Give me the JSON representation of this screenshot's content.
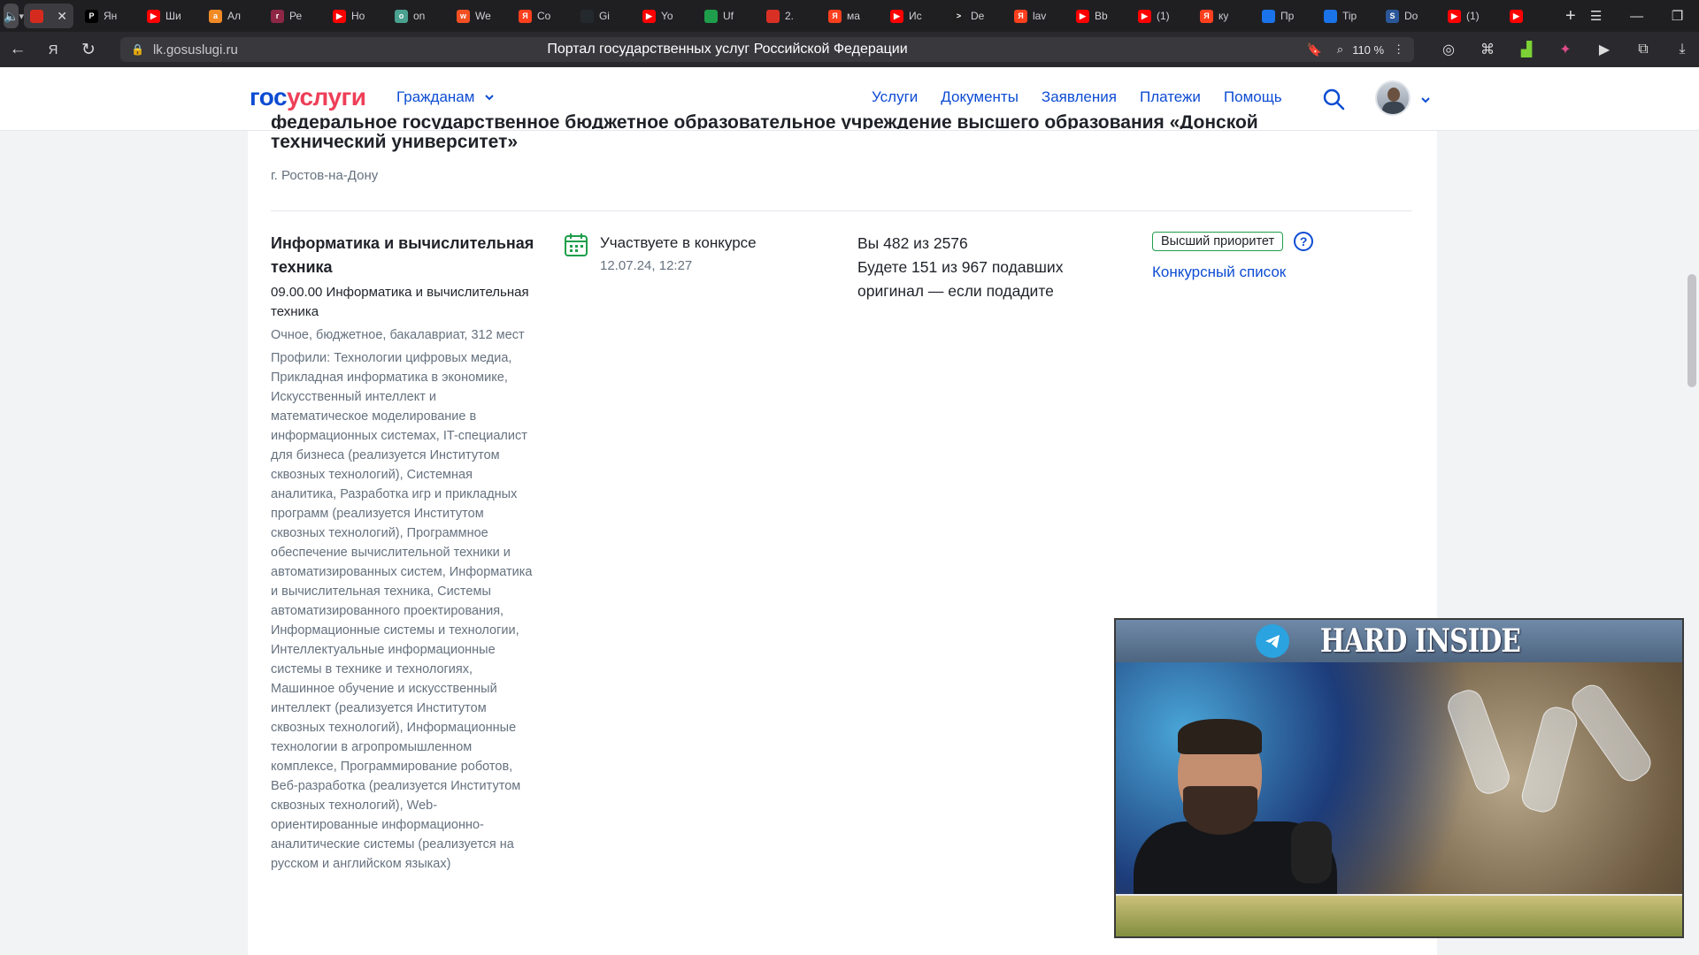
{
  "browser": {
    "tabs": [
      {
        "label": "",
        "icon": "ru-flag",
        "color": "#d52b1e",
        "active": true
      },
      {
        "label": "Ян",
        "icon": "P",
        "color": "#000000"
      },
      {
        "label": "Ши",
        "icon": "youtube",
        "color": "#ff0000"
      },
      {
        "label": "Ал",
        "icon": "a",
        "color": "#f08a24"
      },
      {
        "label": "Ре",
        "icon": "r",
        "color": "#8e2645"
      },
      {
        "label": "Но",
        "icon": "youtube",
        "color": "#ff0000"
      },
      {
        "label": "on",
        "icon": "o",
        "color": "#4aa18f"
      },
      {
        "label": "We",
        "icon": "w",
        "color": "#f25022"
      },
      {
        "label": "Co",
        "icon": "Я",
        "color": "#fc3f1d"
      },
      {
        "label": "Gi",
        "icon": "github",
        "color": "#24292e"
      },
      {
        "label": "Yo",
        "icon": "youtube",
        "color": "#ff0000"
      },
      {
        "label": "Uf",
        "icon": "flask",
        "color": "#1e9e4a"
      },
      {
        "label": "2.",
        "icon": "pdf",
        "color": "#d93025"
      },
      {
        "label": "ма",
        "icon": "Я",
        "color": "#fc3f1d"
      },
      {
        "label": "Ис",
        "icon": "youtube",
        "color": "#ff0000"
      },
      {
        "label": "De",
        "icon": ">",
        "color": "#1e1e1e"
      },
      {
        "label": "lav",
        "icon": "Я",
        "color": "#fc3f1d"
      },
      {
        "label": "Bb",
        "icon": "youtube",
        "color": "#ff0000"
      },
      {
        "label": "(1)",
        "icon": "youtube",
        "color": "#ff0000"
      },
      {
        "label": "ку",
        "icon": "Я",
        "color": "#fc3f1d"
      },
      {
        "label": "Пр",
        "icon": "power",
        "color": "#1a73e8"
      },
      {
        "label": "Tip",
        "icon": "power",
        "color": "#1a73e8"
      },
      {
        "label": "Do",
        "icon": "S",
        "color": "#2b579a"
      },
      {
        "label": "(1)",
        "icon": "youtube",
        "color": "#ff0000"
      },
      {
        "label": "",
        "icon": "youtube",
        "color": "#ff0000"
      }
    ],
    "url": "lk.gosuslugi.ru",
    "page_title": "Портал государственных услуг Российской Федерации",
    "zoom": "110 %"
  },
  "header": {
    "logo_part1": "гос",
    "logo_part2": "услуги",
    "citizens": "Гражданам",
    "nav": [
      "Услуги",
      "Документы",
      "Заявления",
      "Платежи",
      "Помощь"
    ]
  },
  "university": {
    "title_cut": "федеральное государственное бюджетное образовательное учреждение высшего образования «Донской государственный",
    "title_end": "технический университет»",
    "city": "г. Ростов-на-Дону"
  },
  "program": {
    "name": "Информатика и вычислительная техника",
    "code": "09.00.00 Информатика и вычислительная техника",
    "form": "Очное, бюджетное, бакалавриат, 312 мест",
    "profiles": "Профили: Технологии цифровых медиа, Прикладная информатика в экономике, Искусственный интеллект и математическое моделирование в информационных системах, IT-специалист для бизнеса (реализуется Институтом сквозных технологий), Системная аналитика, Разработка игр и прикладных программ (реализуется Институтом сквозных технологий), Программное обеспечение вычислительной техники и автоматизированных систем, Информатика и вычислительная техника, Системы автоматизированного проектирования, Информационные системы и технологии, Интеллектуальные информационные системы в технике и технологиях, Машинное обучение и искусственный интеллект (реализуется Институтом сквозных технологий), Информационные технологии в агропромышленном комплексе, Программирование роботов, Веб-разработка (реализуется Институтом сквозных технологий), Web-ориентированные информационно-аналитические системы (реализуется на русском и английском языках)",
    "status": "Участвуете в конкурсе",
    "status_date": "12.07.24, 12:27",
    "rank_line1": "Вы 482 из 2576",
    "rank_line2": "Будете 151 из 967 подавших оригинал — если подадите",
    "priority_badge": "Высший приоритет",
    "help_label": "?",
    "competition_list": "Конкурсный список"
  },
  "video": {
    "banner_text": "HARD INSIDE"
  },
  "colors": {
    "brand_blue": "#0d4cd3",
    "brand_red": "#ee3f58",
    "badge_green": "#1e9e4a"
  }
}
